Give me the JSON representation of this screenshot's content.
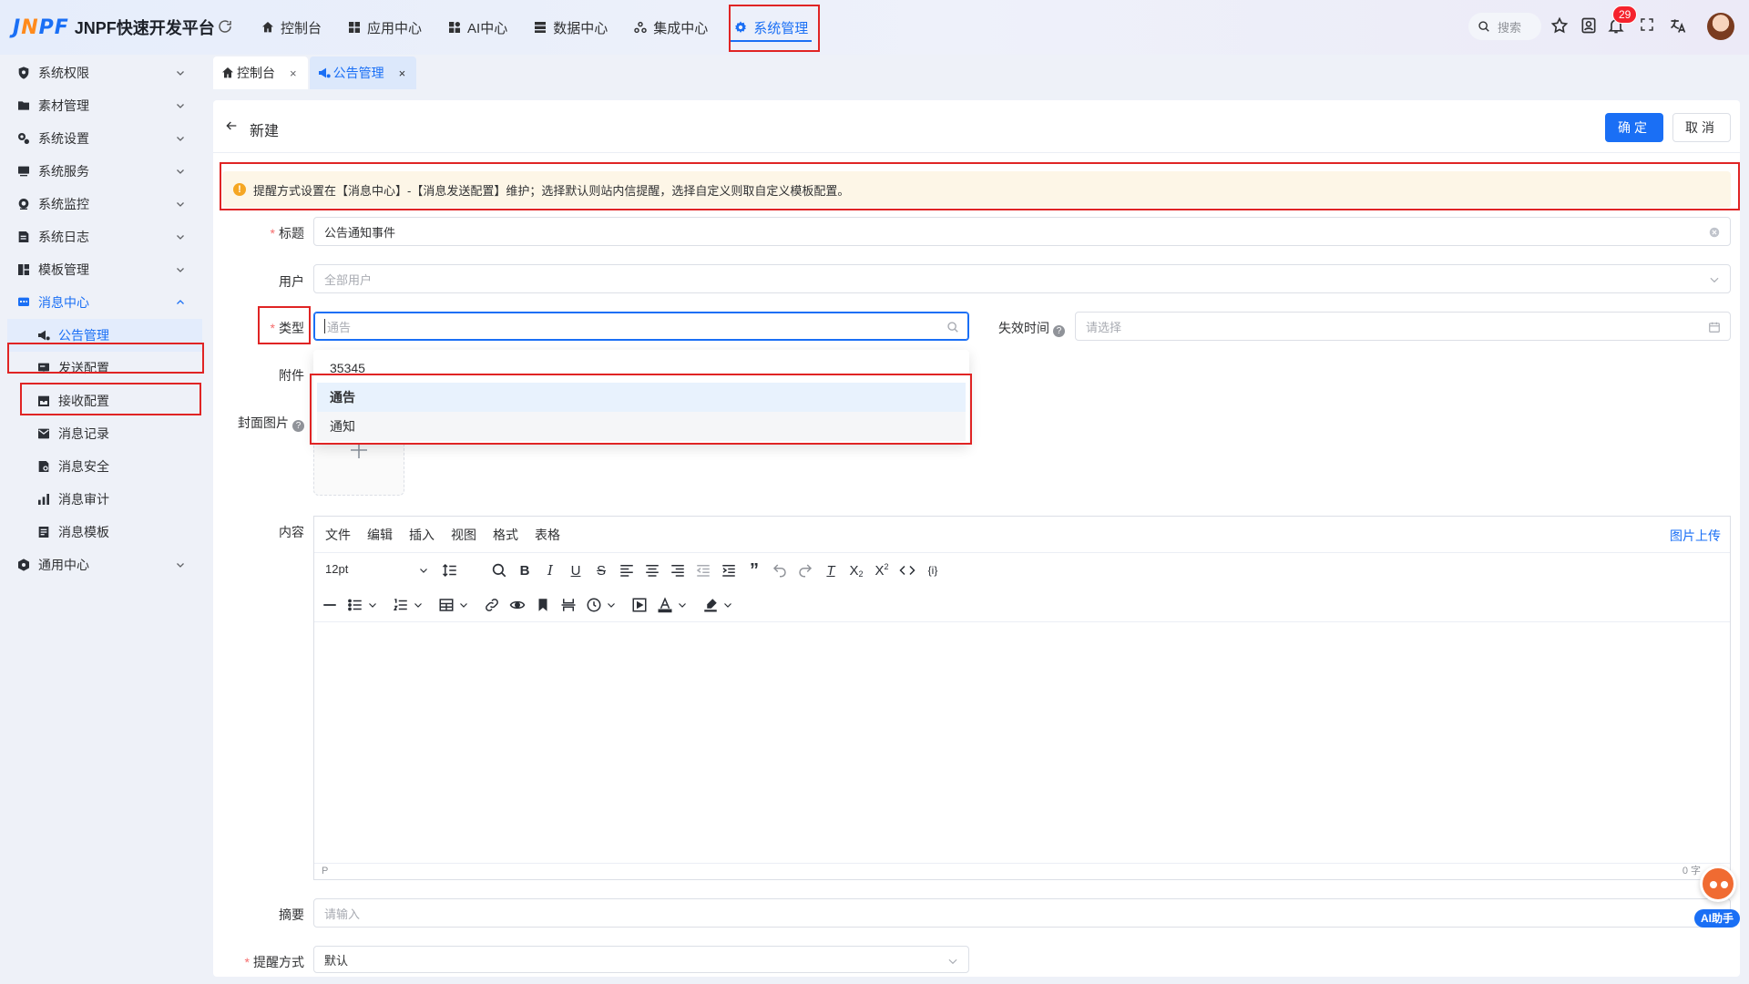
{
  "app": {
    "logo_text": "JNPF",
    "name": "JNPF快速开发平台"
  },
  "topnav": [
    {
      "label": "控制台",
      "icon": "home-icon"
    },
    {
      "label": "应用中心",
      "icon": "grid-icon"
    },
    {
      "label": "AI中心",
      "icon": "ai-grid-icon"
    },
    {
      "label": "数据中心",
      "icon": "database-icon"
    },
    {
      "label": "集成中心",
      "icon": "integration-icon"
    },
    {
      "label": "系统管理",
      "icon": "gear-icon",
      "active": true
    }
  ],
  "header_tools": {
    "search_placeholder": "搜索",
    "notification_count": "29"
  },
  "sidebar": {
    "items": [
      {
        "label": "系统权限"
      },
      {
        "label": "素材管理"
      },
      {
        "label": "系统设置"
      },
      {
        "label": "系统服务"
      },
      {
        "label": "系统监控"
      },
      {
        "label": "系统日志"
      },
      {
        "label": "模板管理"
      },
      {
        "label": "消息中心",
        "expanded": true
      }
    ],
    "sub_items": [
      {
        "label": "公告管理",
        "selected": true
      },
      {
        "label": "发送配置"
      },
      {
        "label": "接收配置"
      },
      {
        "label": "消息记录"
      },
      {
        "label": "消息安全"
      },
      {
        "label": "消息审计"
      },
      {
        "label": "消息模板"
      }
    ],
    "last_item": {
      "label": "通用中心"
    }
  },
  "tabs": [
    {
      "label": "控制台"
    },
    {
      "label": "公告管理",
      "active": true
    }
  ],
  "panel": {
    "title": "新建",
    "ok_label": "确定",
    "cancel_label": "取消",
    "alert": "提醒方式设置在【消息中心】-【消息发送配置】维护；选择默认则站内信提醒，选择自定义则取自定义模板配置。"
  },
  "form": {
    "title_label": "标题",
    "title_value": "公告通知事件",
    "user_label": "用户",
    "user_placeholder": "全部用户",
    "type_label": "类型",
    "type_placeholder": "通告",
    "expire_label": "失效时间",
    "expire_placeholder": "请选择",
    "attach_label": "附件",
    "cover_label": "封面图片",
    "content_label": "内容",
    "summary_label": "摘要",
    "summary_placeholder": "请输入",
    "remind_label": "提醒方式",
    "remind_value": "默认"
  },
  "type_options": [
    {
      "label": "35345"
    },
    {
      "label": "通告",
      "selected": true
    },
    {
      "label": "通知"
    }
  ],
  "editor": {
    "menus": [
      "文件",
      "编辑",
      "插入",
      "视图",
      "格式",
      "表格"
    ],
    "upload_link": "图片上传",
    "font_size": "12pt",
    "status_path": "P",
    "word_count": "0 字"
  },
  "ai_assistant": {
    "label": "AI助手"
  },
  "colors": {
    "primary": "#1a6ff5",
    "highlight_box": "#e02424",
    "alert_bg": "#fdf6e7"
  }
}
